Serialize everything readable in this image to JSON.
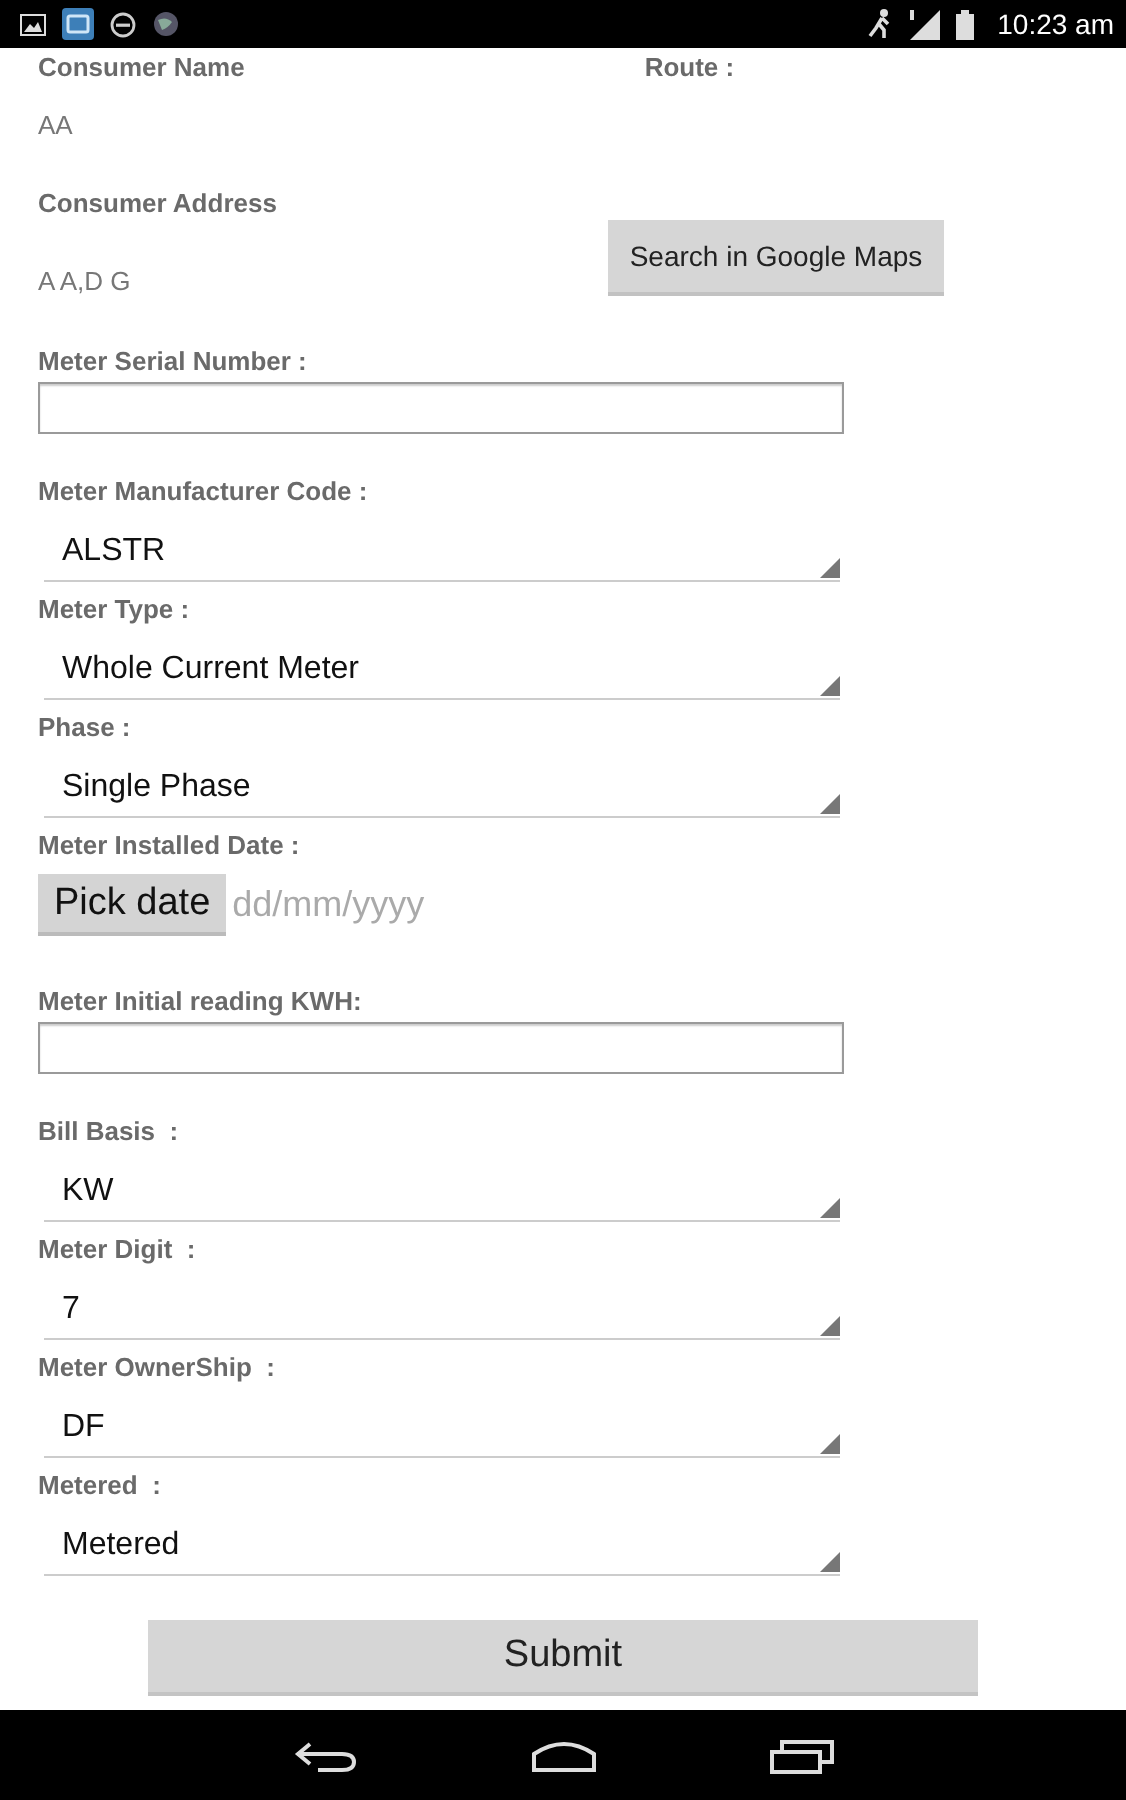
{
  "status_bar": {
    "time": "10:23 am"
  },
  "consumer": {
    "name_label": "Consumer Name",
    "route_label": "Route :",
    "name_value": "AA",
    "address_label": "Consumer Address",
    "address_value": "A A,D G",
    "map_button": "Search in Google Maps"
  },
  "fields": [
    {
      "kind": "input",
      "label": "Meter Serial Number :"
    },
    {
      "kind": "select",
      "label": "Meter Manufacturer Code :",
      "value": "ALSTR"
    },
    {
      "kind": "select",
      "label": "Meter Type :",
      "value": "Whole Current Meter"
    },
    {
      "kind": "select",
      "label": "Phase :",
      "value": "Single Phase"
    },
    {
      "kind": "date",
      "label": "Meter Installed Date :",
      "button": "Pick date",
      "placeholder": "dd/mm/yyyy"
    },
    {
      "kind": "input",
      "label": "Meter Initial reading KWH:"
    },
    {
      "kind": "select",
      "label": "Bill Basis  :",
      "value": "KW"
    },
    {
      "kind": "select",
      "label": "Meter Digit  :",
      "value": "7"
    },
    {
      "kind": "select",
      "label": "Meter OwnerShip  :",
      "value": "DF"
    },
    {
      "kind": "select",
      "label": "Metered  :",
      "value": "Metered"
    }
  ],
  "submit": "Submit"
}
